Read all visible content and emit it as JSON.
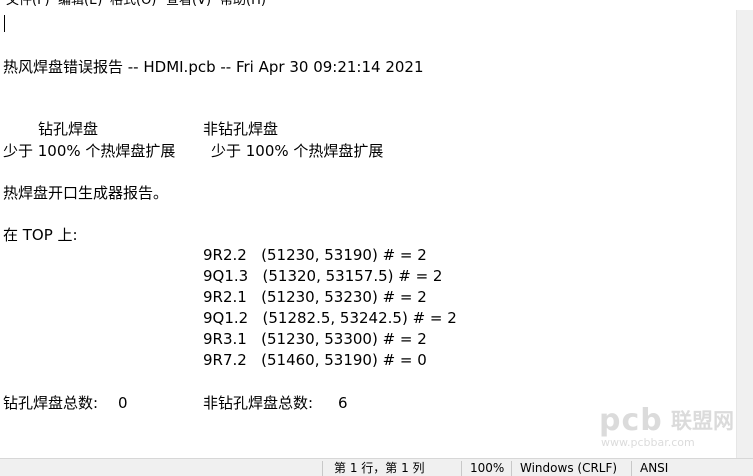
{
  "menu": {
    "items": [
      "文件(F)",
      "编辑(E)",
      "格式(O)",
      "查看(V)",
      "帮助(H)"
    ]
  },
  "document": {
    "title_line": "热风焊盘错误报告 -- HDMI.pcb -- Fri Apr 30 09:21:14 2021",
    "header_drill": "钻孔焊盘",
    "header_nondrill": "非钻孔焊盘",
    "less_drill": "少于 100% 个热焊盘扩展",
    "less_nondrill": "少于 100% 个热焊盘扩展",
    "generator_report": "热焊盘开口生成器报告。",
    "on_top": "在 TOP 上:",
    "entries": [
      "9R2.2   (51230, 53190) # = 2",
      "9Q1.3   (51320, 53157.5) # = 2",
      "9R2.1   (51230, 53230) # = 2",
      "9Q1.2   (51282.5, 53242.5) # = 2",
      "9R3.1   (51230, 53300) # = 2",
      "9R7.2   (51460, 53190) # = 0"
    ],
    "drill_total_label": "钻孔焊盘总数:",
    "drill_total_value": "0",
    "nondrill_total_label": "非钻孔焊盘总数:",
    "nondrill_total_value": "6"
  },
  "watermark": {
    "logo": "pcb",
    "name": "联盟网",
    "url": "www.pcbbar.com"
  },
  "statusbar": {
    "position": "第 1 行，第 1 列",
    "zoom": "100%",
    "line_ending": "Windows (CRLF)",
    "encoding": "ANSI"
  }
}
